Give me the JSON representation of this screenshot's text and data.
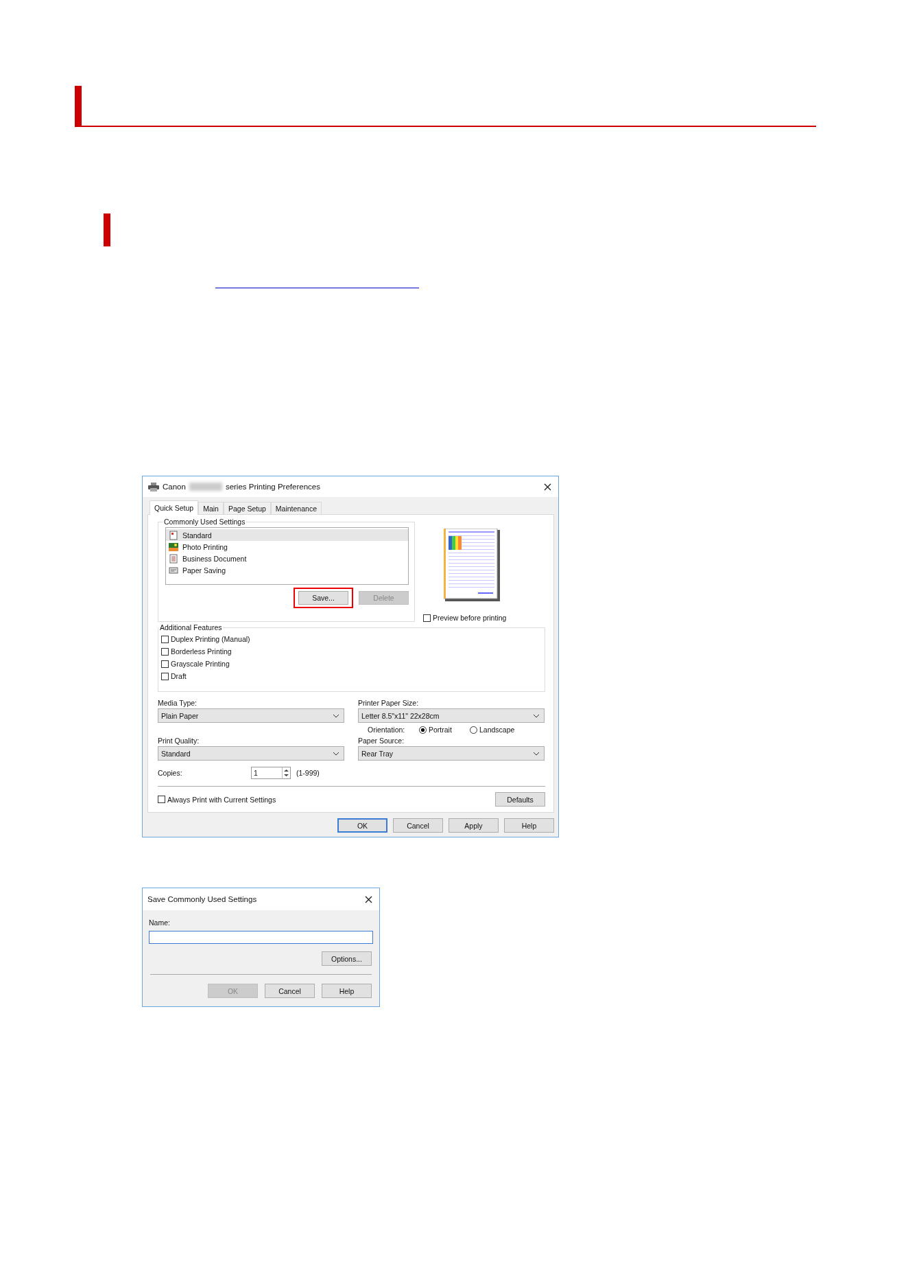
{
  "preferences_dialog": {
    "title_start": "Canon",
    "title_end": "series Printing Preferences",
    "tabs": [
      {
        "label": "Quick Setup",
        "selected": true
      },
      {
        "label": "Main",
        "selected": false
      },
      {
        "label": "Page Setup",
        "selected": false
      },
      {
        "label": "Maintenance",
        "selected": false
      }
    ],
    "commonly_used": {
      "label": "Commonly Used Settings",
      "items": [
        {
          "label": "Standard",
          "kind": "standard",
          "selected": true
        },
        {
          "label": "Photo Printing",
          "kind": "photo",
          "selected": false
        },
        {
          "label": "Business Document",
          "kind": "document",
          "selected": false
        },
        {
          "label": "Paper Saving",
          "kind": "saving",
          "selected": false
        }
      ],
      "save_button": {
        "label": "Save...",
        "highlighted": true
      },
      "delete_button": {
        "label": "Delete",
        "disabled": true
      }
    },
    "preview_checkbox": {
      "label": "Preview before printing",
      "checked": false
    },
    "additional_features": {
      "label": "Additional Features",
      "options": [
        {
          "label": "Duplex Printing (Manual)",
          "checked": false
        },
        {
          "label": "Borderless Printing",
          "checked": false
        },
        {
          "label": "Grayscale Printing",
          "checked": false
        },
        {
          "label": "Draft",
          "checked": false
        }
      ]
    },
    "media_type": {
      "label": "Media Type:",
      "value": "Plain Paper"
    },
    "printer_paper_size": {
      "label": "Printer Paper Size:",
      "value": "Letter 8.5\"x11\" 22x28cm"
    },
    "orientation": {
      "label": "Orientation:",
      "options": [
        {
          "label": "Portrait",
          "selected": true
        },
        {
          "label": "Landscape",
          "selected": false
        }
      ]
    },
    "print_quality": {
      "label": "Print Quality:",
      "value": "Standard"
    },
    "paper_source": {
      "label": "Paper Source:",
      "value": "Rear Tray"
    },
    "copies": {
      "label": "Copies:",
      "value": "1",
      "range": "(1-999)"
    },
    "always_print": {
      "label": "Always Print with Current Settings",
      "checked": false
    },
    "defaults_button": "Defaults",
    "buttons": [
      {
        "label": "OK",
        "focused": true
      },
      {
        "label": "Cancel",
        "focused": false
      },
      {
        "label": "Apply",
        "focused": false
      },
      {
        "label": "Help",
        "focused": false
      }
    ]
  },
  "save_dialog": {
    "title": "Save Commonly Used Settings",
    "name_label": "Name:",
    "name_field": {
      "focused": true
    },
    "options_button": "Options...",
    "buttons": [
      {
        "label": "OK",
        "disabled": true
      },
      {
        "label": "Cancel",
        "disabled": false
      },
      {
        "label": "Help",
        "disabled": false
      }
    ]
  }
}
